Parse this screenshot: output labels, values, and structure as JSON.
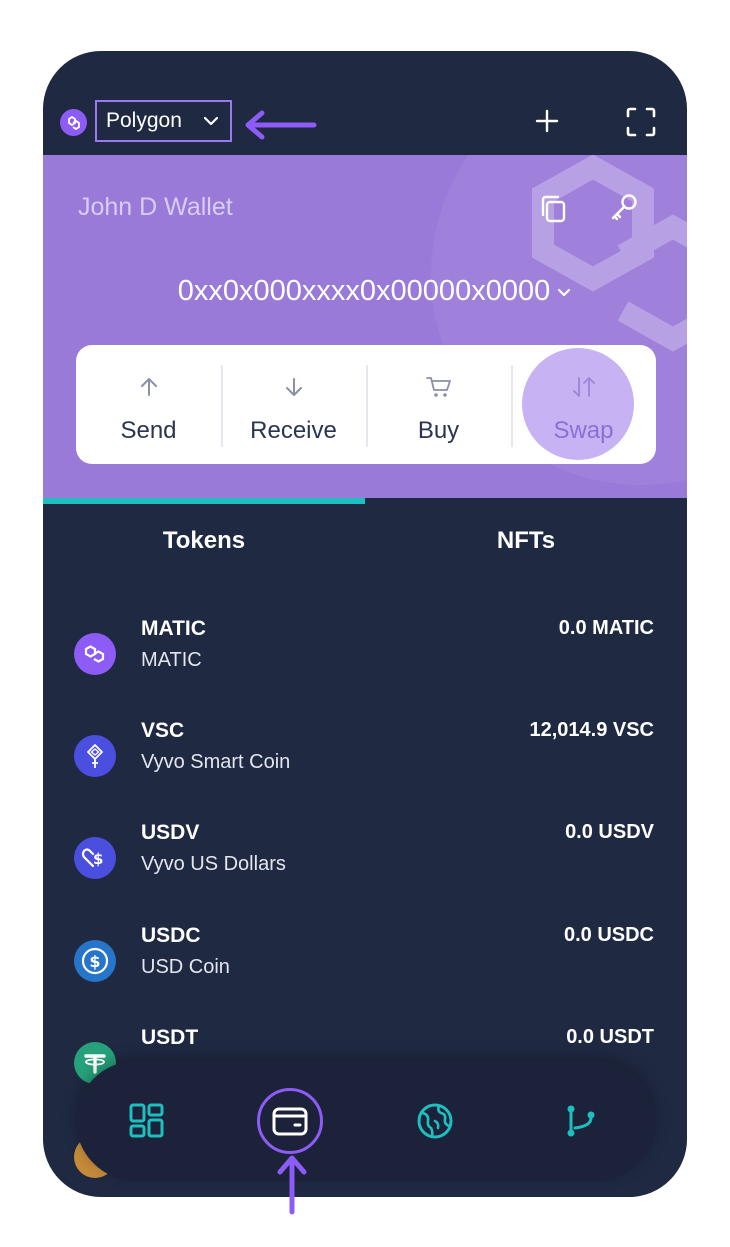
{
  "header": {
    "network": "Polygon"
  },
  "wallet": {
    "name": "John D Wallet",
    "address": "0xx0x000xxxx0x00000x0000"
  },
  "actions": [
    {
      "label": "Send",
      "icon": "arrow-up-icon"
    },
    {
      "label": "Receive",
      "icon": "arrow-down-icon"
    },
    {
      "label": "Buy",
      "icon": "cart-icon"
    },
    {
      "label": "Swap",
      "icon": "swap-icon"
    }
  ],
  "tabs": {
    "active": "Tokens",
    "items": [
      "Tokens",
      "NFTs"
    ]
  },
  "tokens": [
    {
      "symbol": "MATIC",
      "name": "MATIC",
      "amount": "0.0 MATIC",
      "color": "#8d5cf6"
    },
    {
      "symbol": "VSC",
      "name": "Vyvo Smart Coin",
      "amount": "12,014.9 VSC",
      "color": "#4b4fe0"
    },
    {
      "symbol": "USDV",
      "name": "Vyvo US Dollars",
      "amount": "0.0 USDV",
      "color": "#4b4fe0"
    },
    {
      "symbol": "USDC",
      "name": "USD Coin",
      "amount": "0.0 USDC",
      "color": "#2775ca"
    },
    {
      "symbol": "USDT",
      "name": "",
      "amount": "0.0 USDT",
      "color": "#26a17b"
    }
  ],
  "nav": [
    {
      "icon": "dashboard-icon",
      "active": false
    },
    {
      "icon": "wallet-icon",
      "active": true
    },
    {
      "icon": "globe-icon",
      "active": false
    },
    {
      "icon": "git-branch-icon",
      "active": false
    }
  ],
  "colors": {
    "accent": "#8d5cf6",
    "teal": "#1dbfbf",
    "card": "#9a7ad9",
    "background": "#1f2942"
  }
}
